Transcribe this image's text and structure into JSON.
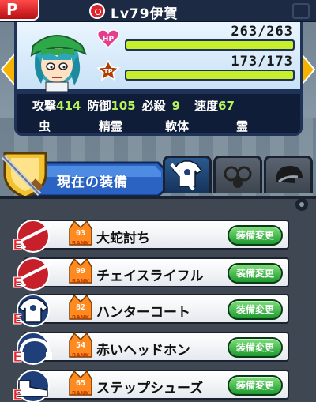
{
  "header": {
    "p_label": "P",
    "level_label": "Lv79",
    "name": "伊賀"
  },
  "status": {
    "hp": {
      "label": "HP",
      "current": 263,
      "max": 263,
      "text": "263/263",
      "color": "#c7ee2c"
    },
    "tp": {
      "label": "TP",
      "current": 173,
      "max": 173,
      "text": "173/173",
      "color": "#c7ee2c"
    }
  },
  "stats": {
    "attack_label": "攻撃",
    "attack": "414",
    "defense_label": "防御",
    "defense": "105",
    "special_label": "必殺",
    "special": "9",
    "speed_label": "速度",
    "speed": "67",
    "traits": [
      "虫",
      "精霊",
      "軟体",
      "霊"
    ]
  },
  "equipment": {
    "title": "現在の装備",
    "items": [
      {
        "icon": "rifle-icon",
        "rank": "03",
        "rank_label": "RANK",
        "name": "大蛇討ち",
        "button": "装備変更"
      },
      {
        "icon": "rifle-icon",
        "rank": "99",
        "rank_label": "RANK",
        "name": "チェイスライフル",
        "button": "装備変更"
      },
      {
        "icon": "shirt-icon",
        "rank": "82",
        "rank_label": "RANK",
        "name": "ハンターコート",
        "button": "装備変更"
      },
      {
        "icon": "headphone-icon",
        "rank": "54",
        "rank_label": "RANK",
        "name": "赤いヘッドホン",
        "button": "装備変更"
      },
      {
        "icon": "shoes-icon",
        "rank": "65",
        "rank_label": "RANK",
        "name": "ステップシューズ",
        "button": "装備変更"
      }
    ]
  },
  "tabs": [
    {
      "icon": "shirt-sword-icon",
      "active": true
    },
    {
      "icon": "accessory-icon",
      "active": false
    },
    {
      "icon": "helmet-icon",
      "active": false
    }
  ],
  "colors": {
    "accent": "#1f3358",
    "button_green": "#1d9a2f",
    "item_red": "#c8202a",
    "value_green": "#b6f25c"
  }
}
